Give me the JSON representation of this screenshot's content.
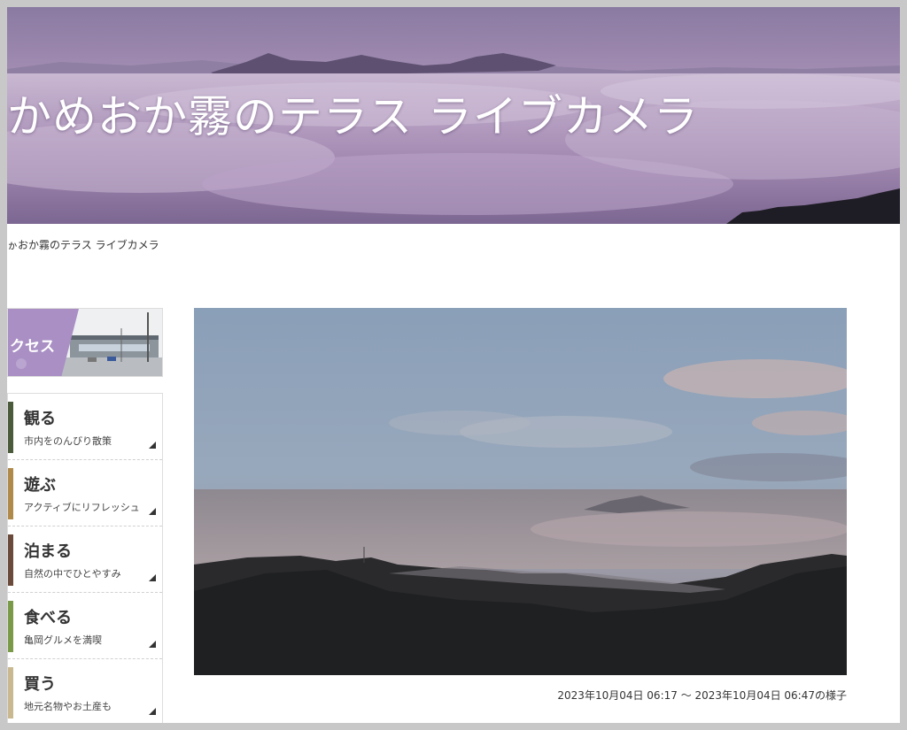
{
  "hero": {
    "title": "かめおか霧のテラス ライブカメラ"
  },
  "breadcrumb": {
    "text": "ゕおか霧のテラス ライブカメラ"
  },
  "sidebar": {
    "access_label": "クセス",
    "items": [
      {
        "title": "観る",
        "subtitle": "市内をのんびり散策"
      },
      {
        "title": "遊ぶ",
        "subtitle": "アクティブにリフレッシュ"
      },
      {
        "title": "泊まる",
        "subtitle": "自然の中でひとやすみ"
      },
      {
        "title": "食べる",
        "subtitle": "亀岡グルメを満喫"
      },
      {
        "title": "買う",
        "subtitle": "地元名物やお土産も"
      }
    ]
  },
  "camera": {
    "caption": "2023年10月04日 06:17 ～ 2023年10月04日 06:47の様子"
  },
  "colors": {
    "accent_purple": "#a98fc4",
    "background_gray": "#c8c8c8"
  }
}
